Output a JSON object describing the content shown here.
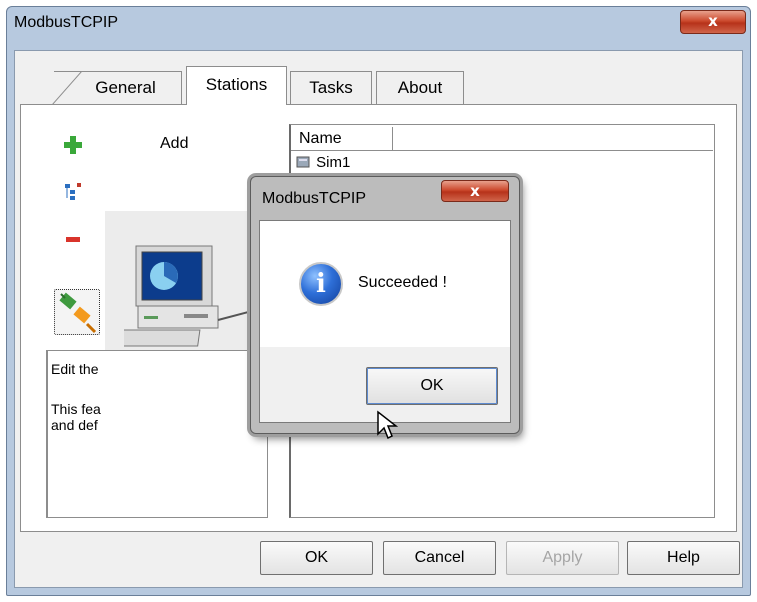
{
  "window": {
    "title": "ModbusTCPIP",
    "close_glyph": "x"
  },
  "tabs": [
    {
      "label": "General"
    },
    {
      "label": "Stations"
    },
    {
      "label": "Tasks"
    },
    {
      "label": "About"
    }
  ],
  "toolbar": {
    "add_label": "Add",
    "icons": [
      "add-icon",
      "properties-icon",
      "remove-icon",
      "connect-plug-icon"
    ]
  },
  "description": {
    "lines": [
      "Edit the",
      "This fea",
      "and def"
    ]
  },
  "stations_list": {
    "column_header": "Name",
    "rows": [
      {
        "name": "Sim1",
        "icon": "station-icon"
      }
    ]
  },
  "buttons": {
    "ok": "OK",
    "cancel": "Cancel",
    "apply": "Apply",
    "help": "Help"
  },
  "dialog": {
    "title": "ModbusTCPIP",
    "close_glyph": "x",
    "message": "Succeeded !",
    "icon": "info-icon",
    "ok": "OK"
  },
  "colors": {
    "close_button": "#cc4a2e",
    "frame": "#b7c9df",
    "info_icon": "#2e6fd8"
  }
}
